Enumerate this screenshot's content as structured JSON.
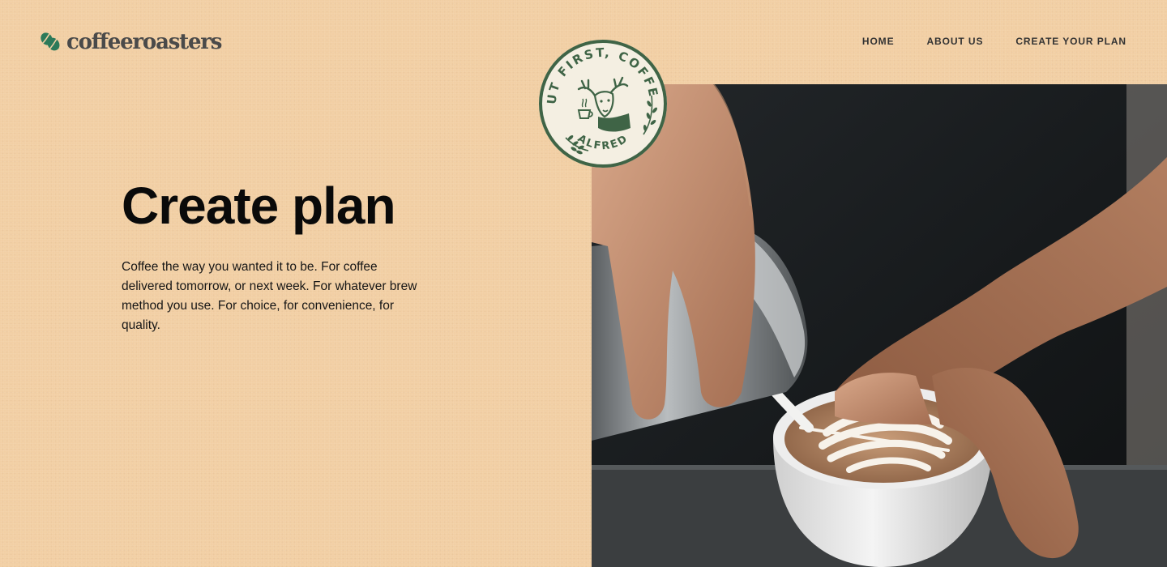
{
  "brand": {
    "name": "coffeeroasters",
    "logo_icon": "coffee-bean-leaf-icon",
    "color_text": "#4A4A4A",
    "color_accent": "#2C7A5A"
  },
  "nav": {
    "items": [
      {
        "label": "HOME"
      },
      {
        "label": "ABOUT US"
      },
      {
        "label": "CREATE YOUR PLAN"
      }
    ]
  },
  "hero": {
    "title": "Create plan",
    "description": "Coffee the way you wanted it to be. For coffee delivered tomorrow, or next week. For whatever brew method you use. For choice, for convenience, for quality.",
    "image_subject": "barista-pouring-latte-art-image"
  },
  "badge": {
    "top_text": "BUT FIRST, COFFEE.",
    "bottom_text": "ALFRED",
    "icon": "stag-with-coffee-cup-icon",
    "color": "#3F6446",
    "background": "#F4EFE2"
  },
  "colors": {
    "background": "#F2CFA4",
    "heading": "#0A0A0A"
  }
}
